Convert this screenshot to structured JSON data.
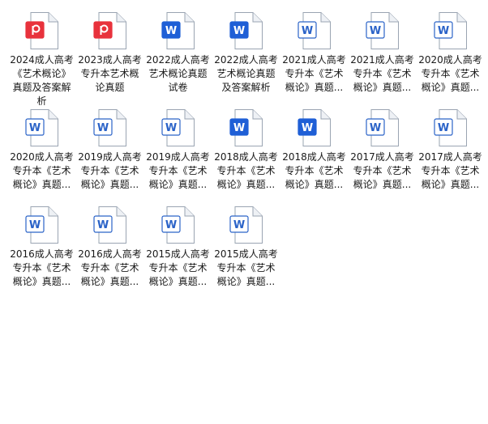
{
  "files": [
    {
      "name": "2024成人高考《艺术概论》真题及答案解析",
      "type": "pdf",
      "icon": "pdf-file-icon",
      "badge": "P"
    },
    {
      "name": "2023成人高考专升本艺术概论真题",
      "type": "pdf",
      "icon": "pdf-file-icon",
      "badge": "P"
    },
    {
      "name": "2022成人高考艺术概论真题试卷",
      "type": "word-blue",
      "icon": "word-file-icon",
      "badge": "W"
    },
    {
      "name": "2022成人高考艺术概论真题及答案解析",
      "type": "word-blue",
      "icon": "word-file-icon",
      "badge": "W"
    },
    {
      "name": "2021成人高考专升本《艺术概论》真题...",
      "type": "word",
      "icon": "word-file-icon",
      "badge": "W"
    },
    {
      "name": "2021成人高考专升本《艺术概论》真题...",
      "type": "word",
      "icon": "word-file-icon",
      "badge": "W"
    },
    {
      "name": "2020成人高考专升本《艺术概论》真题...",
      "type": "word",
      "icon": "word-file-icon",
      "badge": "W"
    },
    {
      "name": "2020成人高考专升本《艺术概论》真题...",
      "type": "word",
      "icon": "word-file-icon",
      "badge": "W"
    },
    {
      "name": "2019成人高考专升本《艺术概论》真题...",
      "type": "word",
      "icon": "word-file-icon",
      "badge": "W"
    },
    {
      "name": "2019成人高考专升本《艺术概论》真题...",
      "type": "word",
      "icon": "word-file-icon",
      "badge": "W"
    },
    {
      "name": "2018成人高考专升本《艺术概论》真题...",
      "type": "word-blue",
      "icon": "word-file-icon",
      "badge": "W"
    },
    {
      "name": "2018成人高考专升本《艺术概论》真题...",
      "type": "word-blue",
      "icon": "word-file-icon",
      "badge": "W"
    },
    {
      "name": "2017成人高考专升本《艺术概论》真题...",
      "type": "word",
      "icon": "word-file-icon",
      "badge": "W"
    },
    {
      "name": "2017成人高考专升本《艺术概论》真题...",
      "type": "word",
      "icon": "word-file-icon",
      "badge": "W"
    },
    {
      "name": "2016成人高考专升本《艺术概论》真题...",
      "type": "word",
      "icon": "word-file-icon",
      "badge": "W"
    },
    {
      "name": "2016成人高考专升本《艺术概论》真题...",
      "type": "word",
      "icon": "word-file-icon",
      "badge": "W"
    },
    {
      "name": "2015成人高考专升本《艺术概论》真题...",
      "type": "word",
      "icon": "word-file-icon",
      "badge": "W"
    },
    {
      "name": "2015成人高考专升本《艺术概论》真题...",
      "type": "word",
      "icon": "word-file-icon",
      "badge": "W"
    }
  ],
  "colors": {
    "pdf": "#e8323c",
    "word_solid": "#1f5fd6",
    "word_outline": "#2b63c8",
    "page_border": "#9aa4b2",
    "text": "#1a1a1a"
  }
}
